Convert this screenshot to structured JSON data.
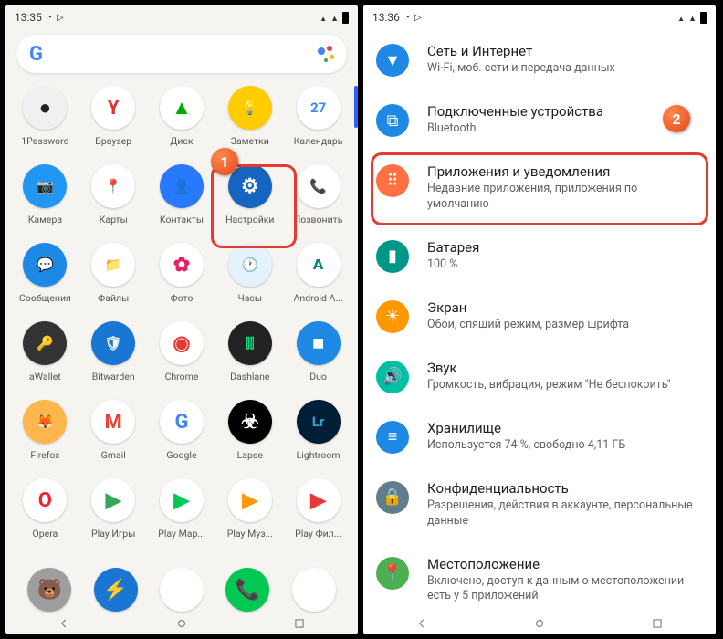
{
  "left": {
    "status_time": "13:35",
    "apps": [
      [
        "1Password",
        "#f0f0f0",
        "#222",
        "●"
      ],
      [
        "Браузер",
        "#fff",
        "#d33",
        "Y"
      ],
      [
        "Диск",
        "#fff",
        "#0a0",
        "▲"
      ],
      [
        "Заметки",
        "#ffcc00",
        "#fff",
        "💡"
      ],
      [
        "Календарь",
        "#fff",
        "#4285F4",
        "27"
      ],
      [
        "Камера",
        "#2196f3",
        "#fff",
        "📷"
      ],
      [
        "Карты",
        "#fff",
        "#34a853",
        "📍"
      ],
      [
        "Контакты",
        "#2979ff",
        "#fff",
        "👤"
      ],
      [
        "Настройки",
        "#1565c0",
        "#fff",
        "⚙"
      ],
      [
        "Позвонить",
        "#fff",
        "#1e88e5",
        "📞"
      ],
      [
        "Сообщения",
        "#1e88e5",
        "#fff",
        "💬"
      ],
      [
        "Файлы",
        "#fff",
        "#444",
        "📁"
      ],
      [
        "Фото",
        "#fff",
        "#e91e63",
        "✿"
      ],
      [
        "Часы",
        "#e3f2fd",
        "#1976d2",
        "🕐"
      ],
      [
        "Android A...",
        "#fff",
        "#00897b",
        "𝗔"
      ],
      [
        "aWallet",
        "#333",
        "#ffc107",
        "🔑"
      ],
      [
        "Bitwarden",
        "#1976d2",
        "#fff",
        "🛡"
      ],
      [
        "Chrome",
        "#fff",
        "#e53935",
        "◉"
      ],
      [
        "Dashlane",
        "#222",
        "#0bda7c",
        "⫿⫿"
      ],
      [
        "Duo",
        "#1e88e5",
        "#fff",
        "■"
      ],
      [
        "Firefox",
        "#ffb74d",
        "#7b1fa2",
        "🦊"
      ],
      [
        "Gmail",
        "#fff",
        "#ea4335",
        "M"
      ],
      [
        "Google",
        "#fff",
        "#4285F4",
        "G"
      ],
      [
        "Lapse",
        "#000",
        "#fff",
        "☣"
      ],
      [
        "Lightroom",
        "#001e36",
        "#2fa3d6",
        "Lr"
      ],
      [
        "Opera",
        "#fff",
        "#ff1b2d",
        "O"
      ],
      [
        "Play Игры",
        "#fff",
        "#34a853",
        "▶"
      ],
      [
        "Play Мар...",
        "#fff",
        "#00c853",
        "▶"
      ],
      [
        "Play Муз...",
        "#fff",
        "#ff9800",
        "▶"
      ],
      [
        "Play Фил...",
        "#fff",
        "#e53935",
        "▶"
      ]
    ],
    "dock": [
      [
        "#9e9e9e",
        "🐻"
      ],
      [
        "#1976d2",
        "⚡"
      ],
      [
        "#fff",
        "◉"
      ],
      [
        "#00c853",
        "📞"
      ],
      [
        "#fff",
        "▶"
      ]
    ],
    "badge": "1"
  },
  "right": {
    "status_time": "13:36",
    "items": [
      {
        "t": "Сеть и Интернет",
        "s": "Wi-Fi, моб. сети и передача данных",
        "c": "#1e88e5",
        "i": "▼"
      },
      {
        "t": "Подключенные устройства",
        "s": "Bluetooth",
        "c": "#1e88e5",
        "i": "⧉"
      },
      {
        "t": "Приложения и уведомления",
        "s": "Недавние приложения, приложения по умолчанию",
        "c": "#ff7043",
        "i": "⠿"
      },
      {
        "t": "Батарея",
        "s": "100 %",
        "c": "#009688",
        "i": "▮"
      },
      {
        "t": "Экран",
        "s": "Обои, спящий режим, размер шрифта",
        "c": "#ff9800",
        "i": "☀"
      },
      {
        "t": "Звук",
        "s": "Громкость, вибрация, режим \"Не беспокоить\"",
        "c": "#00bfa5",
        "i": "🔊"
      },
      {
        "t": "Хранилище",
        "s": "Используется 74 %, свободно 4,11 ГБ",
        "c": "#1e88e5",
        "i": "≡"
      },
      {
        "t": "Конфиденциальность",
        "s": "Разрешения, действия в аккаунте, персональные данные",
        "c": "#607d8b",
        "i": "🔒"
      },
      {
        "t": "Местоположение",
        "s": "Включено, доступ к данным о местоположении есть у 5 приложений",
        "c": "#4caf50",
        "i": "📍"
      }
    ],
    "badge": "2"
  }
}
